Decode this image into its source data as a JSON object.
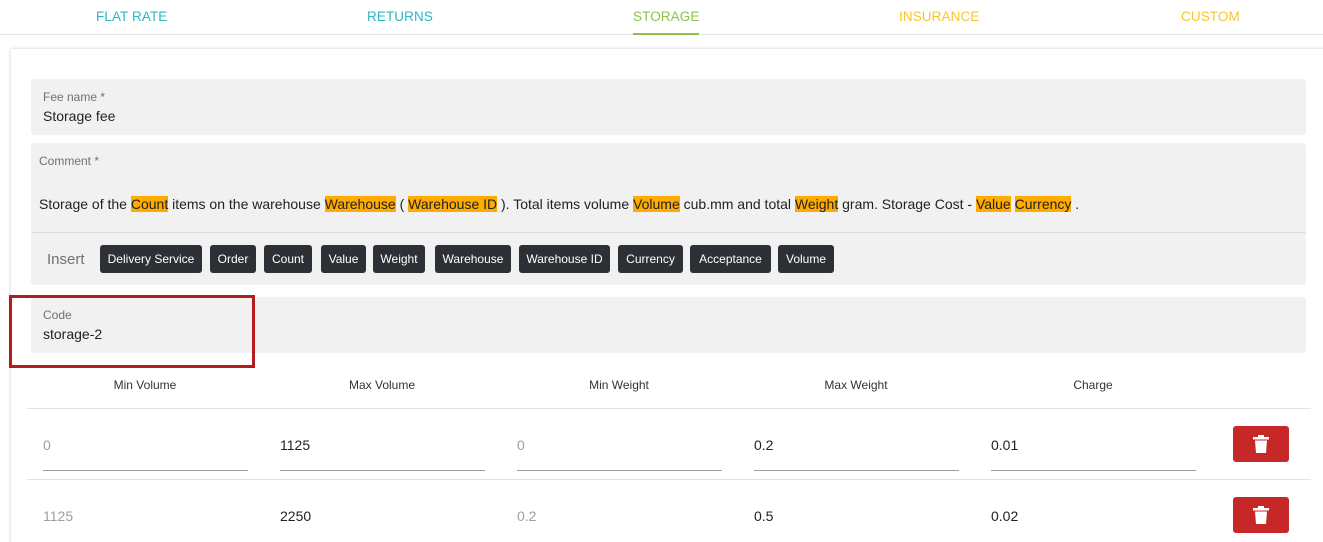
{
  "tabs": [
    "FLAT RATE",
    "RETURNS",
    "STORAGE",
    "INSURANCE",
    "CUSTOM"
  ],
  "active_tab": "STORAGE",
  "fee_name": {
    "label": "Fee name *",
    "value": "Storage fee"
  },
  "comment": {
    "label": "Comment *",
    "segments": [
      {
        "text": "Storage of the ",
        "tag": false
      },
      {
        "text": "Count",
        "tag": true
      },
      {
        "text": " items on the warehouse ",
        "tag": false
      },
      {
        "text": "Warehouse",
        "tag": true
      },
      {
        "text": " ( ",
        "tag": false
      },
      {
        "text": "Warehouse ID",
        "tag": true
      },
      {
        "text": " ). Total items volume ",
        "tag": false
      },
      {
        "text": "Volume",
        "tag": true
      },
      {
        "text": " cub.mm and total ",
        "tag": false
      },
      {
        "text": "Weight",
        "tag": true
      },
      {
        "text": " gram. Storage Cost - ",
        "tag": false
      },
      {
        "text": "Value",
        "tag": true
      },
      {
        "text": " ",
        "tag": false
      },
      {
        "text": "Currency",
        "tag": true
      },
      {
        "text": " .",
        "tag": false
      }
    ]
  },
  "insert": {
    "label": "Insert",
    "chips": [
      "Delivery Service",
      "Order",
      "Count",
      "Value",
      "Weight",
      "Warehouse",
      "Warehouse ID",
      "Currency",
      "Acceptance",
      "Volume"
    ]
  },
  "code": {
    "label": "Code",
    "value": "storage-2"
  },
  "table": {
    "headers": [
      "Min Volume",
      "Max Volume",
      "Min Weight",
      "Max Weight",
      "Charge"
    ],
    "rows": [
      {
        "min_volume": "0",
        "max_volume": "1125",
        "min_weight": "0",
        "max_weight": "0.2",
        "charge": "0.01"
      },
      {
        "min_volume": "1125",
        "max_volume": "2250",
        "min_weight": "0.2",
        "max_weight": "0.5",
        "charge": "0.02"
      }
    ]
  },
  "colors": {
    "tab_teal": "#2fb5c3",
    "tab_active": "#8bc34a",
    "tab_yellow": "#f7c52b",
    "tag_highlight": "#ffab00",
    "chip_bg": "#2d3136",
    "delete_button": "#c62828",
    "annotation_box": "#b71c1c"
  },
  "icons": {
    "delete": "trash-icon"
  }
}
